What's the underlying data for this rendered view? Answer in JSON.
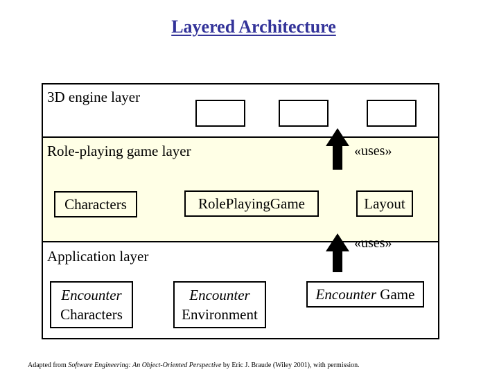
{
  "title": "Layered Architecture",
  "layers": {
    "engine": {
      "label": "3D engine layer",
      "placeholder_box_count": 3
    },
    "rpg": {
      "label": "Role-playing game layer",
      "packages": [
        "Characters",
        "RolePlayingGame",
        "Layout"
      ]
    },
    "application": {
      "label": "Application layer",
      "packages": [
        {
          "italic": "Encounter",
          "plain": "Characters"
        },
        {
          "italic": "Encounter",
          "plain": "Environment"
        },
        {
          "italic": "Encounter",
          "plain": "Game"
        }
      ]
    }
  },
  "dependencies": [
    {
      "from": "Role-playing game layer",
      "to": "3D engine layer",
      "label": "«uses»"
    },
    {
      "from": "Application layer",
      "to": "Role-playing game layer",
      "label": "«uses»"
    }
  ],
  "footer": {
    "prefix": "Adapted from ",
    "book_title": "Software Engineering: An Object-Oriented Perspective",
    "suffix": " by Eric J. Braude (Wiley 2001), with permission."
  }
}
